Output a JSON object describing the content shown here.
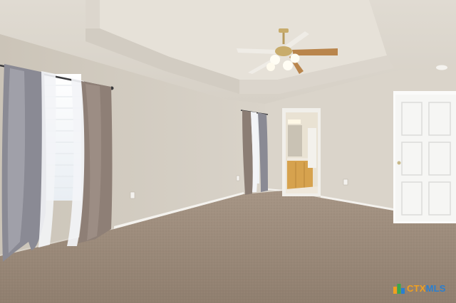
{
  "watermark": {
    "brand_primary": "CTX",
    "brand_secondary": "MLS"
  },
  "colors": {
    "wall": "#d9d3c9",
    "wall_left": "#cfc8bd",
    "ceiling": "#e4dfd6",
    "carpet": "#9d8c7c",
    "baseboard": "#f4f2ee",
    "door": "#f6f6f4",
    "cabinet": "#d9a850",
    "curtain_grey": "#8b8a93",
    "curtain_brown": "#8f8077",
    "curtain_sheer": "#f2f3f6",
    "window_light": "#f7f9fb",
    "fan_blade": "#b9854c",
    "watermark_orange": "#f0a020",
    "watermark_blue": "#2a7fd0"
  }
}
